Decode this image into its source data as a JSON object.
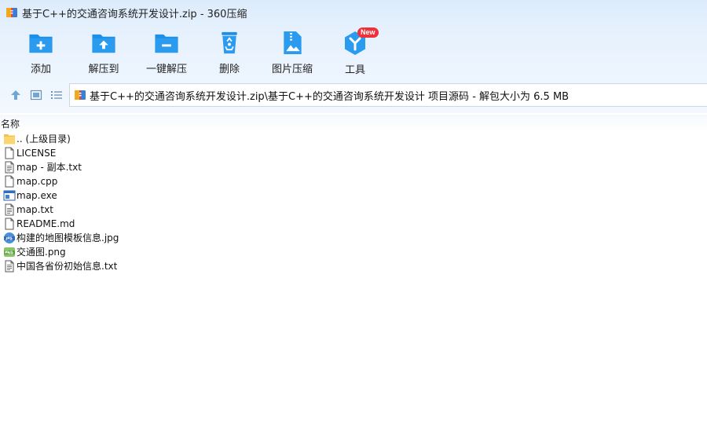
{
  "window": {
    "title": "基于C++的交通咨询系统开发设计.zip - 360压缩"
  },
  "toolbar": {
    "items": [
      {
        "label": "添加",
        "icon": "add-folder-icon"
      },
      {
        "label": "解压到",
        "icon": "extract-to-icon"
      },
      {
        "label": "一键解压",
        "icon": "one-click-extract-icon"
      },
      {
        "label": "删除",
        "icon": "recycle-bin-icon"
      },
      {
        "label": "图片压缩",
        "icon": "image-compress-icon"
      },
      {
        "label": "工具",
        "icon": "tools-icon",
        "badge": "New"
      }
    ]
  },
  "address": {
    "path": "基于C++的交通咨询系统开发设计.zip\\基于C++的交通咨询系统开发设计 项目源码 - 解包大小为 6.5 MB"
  },
  "columns": {
    "name": "名称"
  },
  "files": [
    {
      "name": ".. (上级目录)",
      "type": "parent-folder"
    },
    {
      "name": "LICENSE",
      "type": "file"
    },
    {
      "name": "map - 副本.txt",
      "type": "text"
    },
    {
      "name": "map.cpp",
      "type": "file"
    },
    {
      "name": "map.exe",
      "type": "exe"
    },
    {
      "name": "map.txt",
      "type": "text"
    },
    {
      "name": "README.md",
      "type": "file"
    },
    {
      "name": "构建的地图模板信息.jpg",
      "type": "jpg"
    },
    {
      "name": "交通图.png",
      "type": "png"
    },
    {
      "name": "中国各省份初始信息.txt",
      "type": "text"
    }
  ],
  "colors": {
    "accent_blue": "#1e8fe6",
    "toolbar_bg": "#e6f1fd",
    "badge_red": "#f0303a"
  }
}
